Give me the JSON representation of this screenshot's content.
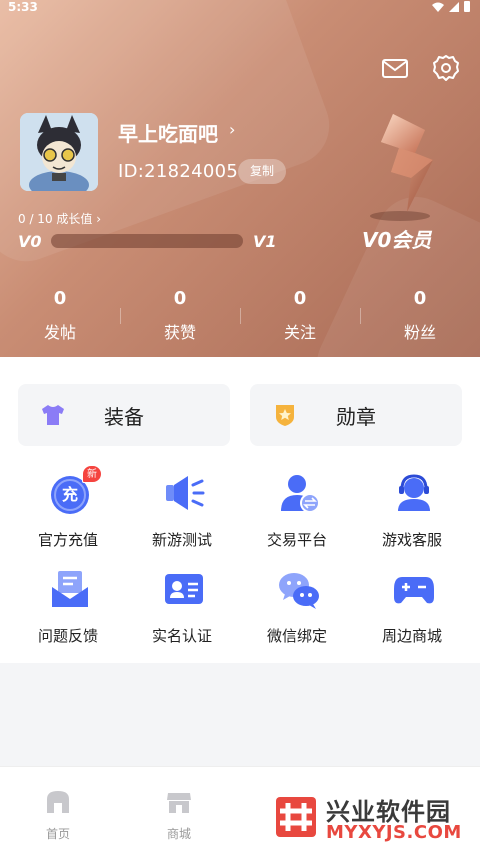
{
  "status_bar": {
    "time": "5:33"
  },
  "profile": {
    "username": "早上吃面吧",
    "username_chevron": "›",
    "user_id": "ID:21824005",
    "copy_label": "复制",
    "growth_text": "0 / 10 成长值 ›",
    "level_current": "V0",
    "level_next": "V1",
    "level_progress": 0,
    "vip_label": "V0会员"
  },
  "stats": [
    {
      "value": "0",
      "label": "发帖"
    },
    {
      "value": "0",
      "label": "获赞"
    },
    {
      "value": "0",
      "label": "关注"
    },
    {
      "value": "0",
      "label": "粉丝"
    }
  ],
  "quick_buttons": {
    "equipment": "装备",
    "medal": "勋章"
  },
  "services": [
    {
      "label": "官方充值",
      "icon": "recharge-icon",
      "badge": "新",
      "glyph": "充"
    },
    {
      "label": "新游测试",
      "icon": "megaphone-icon"
    },
    {
      "label": "交易平台",
      "icon": "trade-icon"
    },
    {
      "label": "游戏客服",
      "icon": "headset-icon"
    },
    {
      "label": "问题反馈",
      "icon": "feedback-icon"
    },
    {
      "label": "实名认证",
      "icon": "id-card-icon"
    },
    {
      "label": "微信绑定",
      "icon": "wechat-icon"
    },
    {
      "label": "周边商城",
      "icon": "gamepad-icon"
    }
  ],
  "bottom_nav": [
    {
      "label": "首页",
      "icon": "home-icon"
    },
    {
      "label": "商城",
      "icon": "shop-icon"
    }
  ],
  "watermark": {
    "title": "兴业软件园",
    "url": "MYXYJS.COM"
  },
  "colors": {
    "header_gradient": [
      "#e8b9a0",
      "#a86a55"
    ],
    "icon_blue": "#4a6cf7",
    "badge_red": "#f5443f"
  }
}
